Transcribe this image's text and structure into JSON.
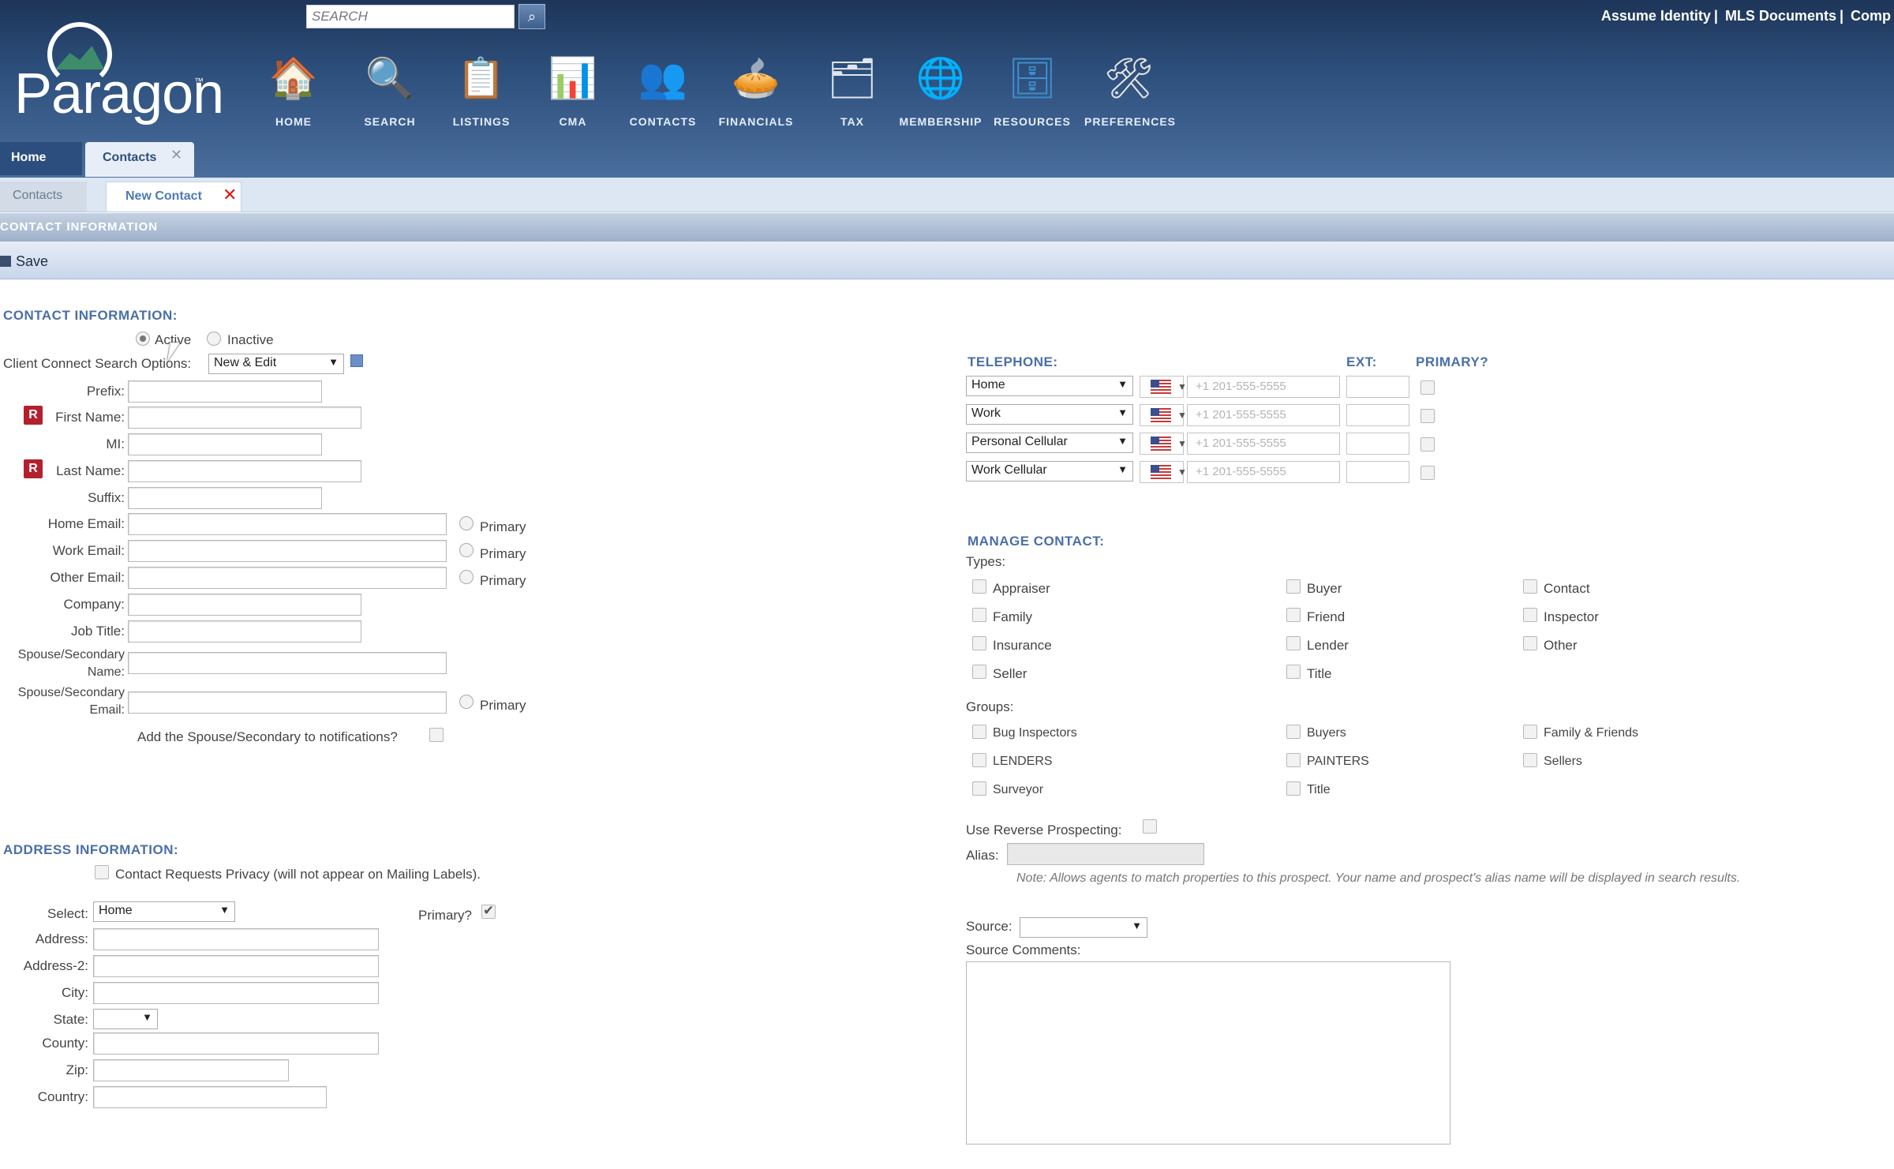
{
  "header": {
    "logo_text": "Paragon",
    "logo_tm": "™",
    "search_placeholder": "SEARCH",
    "links": [
      "Assume Identity",
      "MLS Documents",
      "Comp"
    ],
    "nav": [
      {
        "label": "HOME",
        "icon": "home-icon",
        "glyph": "🏠"
      },
      {
        "label": "SEARCH",
        "icon": "search-doc-icon",
        "glyph": "🔍"
      },
      {
        "label": "LISTINGS",
        "icon": "listings-icon",
        "glyph": "📋"
      },
      {
        "label": "CMA",
        "icon": "cma-icon",
        "glyph": "📊"
      },
      {
        "label": "CONTACTS",
        "icon": "contacts-icon",
        "glyph": "👥"
      },
      {
        "label": "FINANCIALS",
        "icon": "financials-icon",
        "glyph": "🥧"
      },
      {
        "label": "TAX",
        "icon": "tax-icon",
        "glyph": "🗂"
      },
      {
        "label": "MEMBERSHIP",
        "icon": "membership-icon",
        "glyph": "🌐"
      },
      {
        "label": "RESOURCES",
        "icon": "resources-icon",
        "glyph": "🗄"
      },
      {
        "label": "PREFERENCES",
        "icon": "preferences-icon",
        "glyph": "🛠"
      }
    ]
  },
  "tabs": {
    "home": "Home",
    "contacts": "Contacts",
    "close": "✕"
  },
  "subtabs": {
    "contacts": "Contacts",
    "new_contact": "New Contact",
    "close": "✕"
  },
  "section_header": "CONTACT INFORMATION",
  "toolbar": {
    "save": "Save"
  },
  "contact": {
    "heading": "CONTACT INFORMATION:",
    "active": "Active",
    "inactive": "Inactive",
    "client_connect_label": "Client Connect Search Options:",
    "client_connect_value": "New & Edit",
    "prefix": "Prefix:",
    "first_name": "First Name:",
    "mi": "MI:",
    "last_name": "Last Name:",
    "suffix": "Suffix:",
    "home_email": "Home Email:",
    "work_email": "Work Email:",
    "other_email": "Other Email:",
    "company": "Company:",
    "job_title": "Job Title:",
    "spouse_name_1": "Spouse/Secondary",
    "spouse_name_2": "Name:",
    "spouse_email_1": "Spouse/Secondary",
    "spouse_email_2": "Email:",
    "primary": "Primary",
    "add_spouse": "Add the Spouse/Secondary to notifications?",
    "required_mark": "R"
  },
  "address": {
    "heading": "ADDRESS INFORMATION:",
    "privacy": "Contact Requests Privacy (will not appear on Mailing Labels).",
    "select_label": "Select:",
    "select_value": "Home",
    "primary_q": "Primary?",
    "address": "Address:",
    "address2": "Address-2:",
    "city": "City:",
    "state": "State:",
    "county": "County:",
    "zip": "Zip:",
    "country": "Country:"
  },
  "telephone": {
    "heading": "TELEPHONE:",
    "ext": "EXT:",
    "primary": "PRIMARY?",
    "placeholder": "+1 201-555-5555",
    "rows": [
      "Home",
      "Work",
      "Personal Cellular",
      "Work Cellular"
    ]
  },
  "manage": {
    "heading": "MANAGE CONTACT:",
    "types_label": "Types:",
    "types": [
      "Appraiser",
      "Buyer",
      "Contact",
      "Family",
      "Friend",
      "Inspector",
      "Insurance",
      "Lender",
      "Other",
      "Seller",
      "Title"
    ],
    "groups_label": "Groups:",
    "groups": [
      "Bug Inspectors",
      "Buyers",
      "Family & Friends",
      "LENDERS",
      "PAINTERS",
      "Sellers",
      "Surveyor",
      "Title"
    ],
    "reverse_prospecting": "Use Reverse Prospecting:",
    "alias": "Alias:",
    "note": "Note: Allows agents to match properties to this prospect. Your name and prospect's alias name will be displayed in search results.",
    "source": "Source:",
    "source_comments": "Source Comments:"
  }
}
